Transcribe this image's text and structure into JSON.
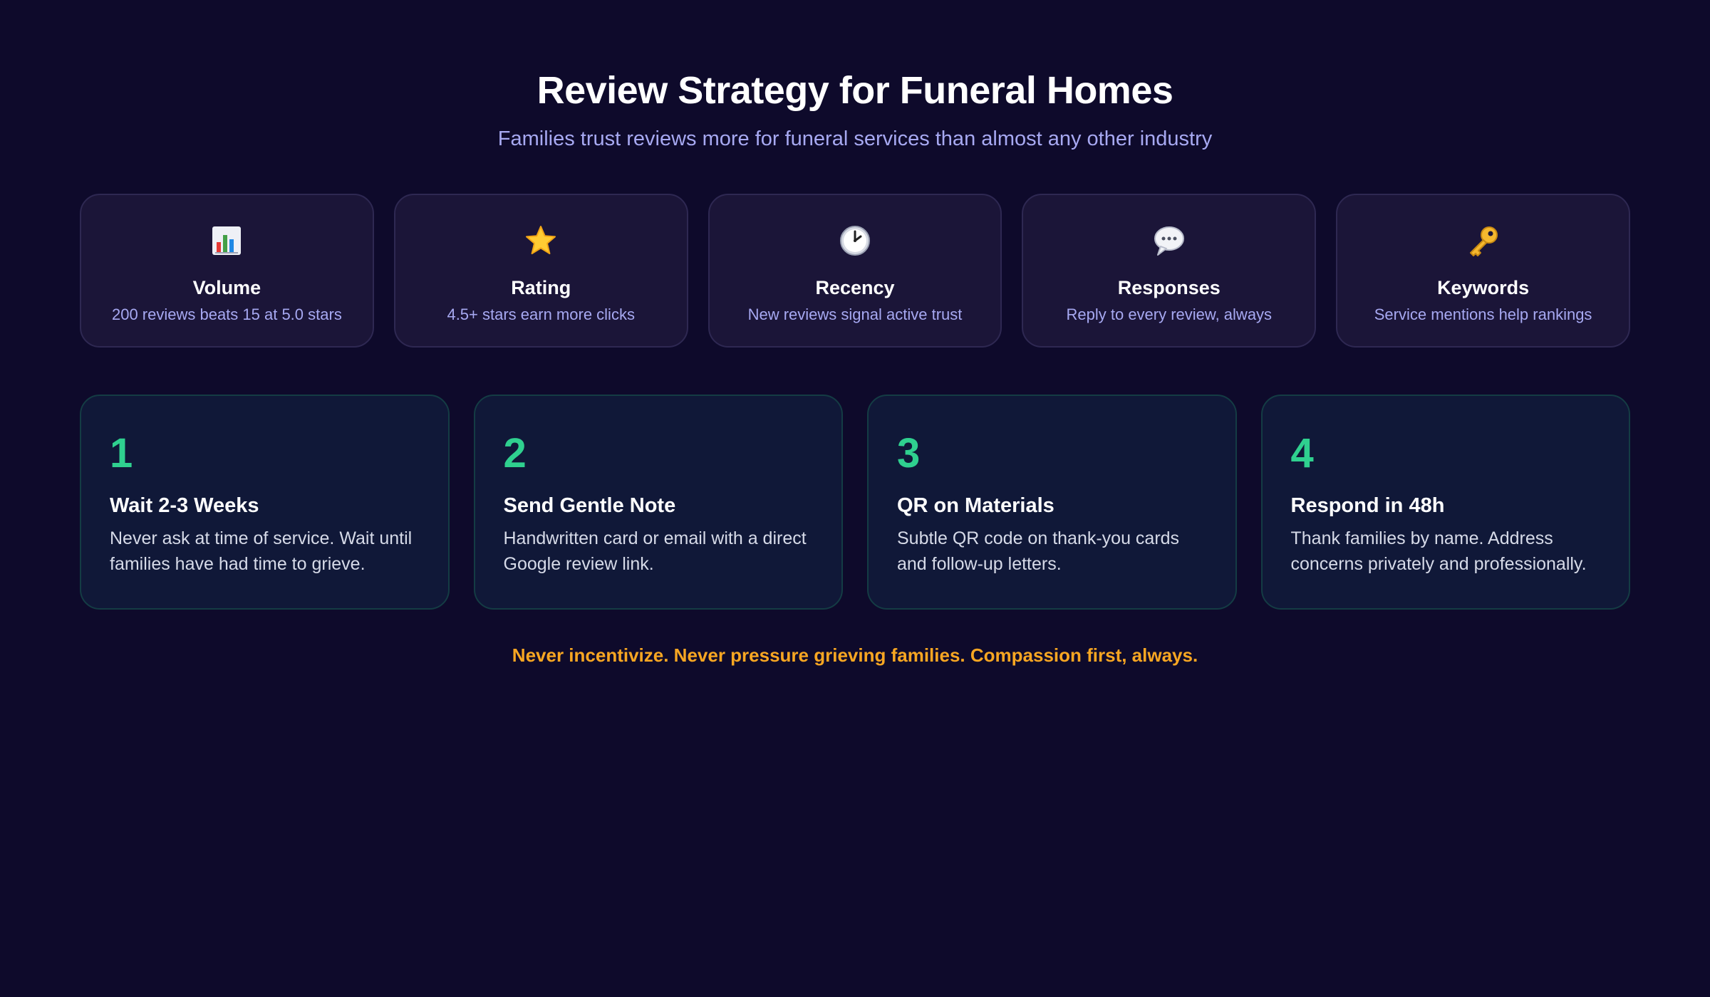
{
  "header": {
    "title": "Review Strategy for Funeral Homes",
    "subtitle": "Families trust reviews more for funeral services than almost any other industry"
  },
  "factors": [
    {
      "icon": "bar-chart-icon",
      "title": "Volume",
      "description": "200 reviews beats 15 at 5.0 stars"
    },
    {
      "icon": "star-icon",
      "title": "Rating",
      "description": "4.5+ stars earn more clicks"
    },
    {
      "icon": "clock-icon",
      "title": "Recency",
      "description": "New reviews signal active trust"
    },
    {
      "icon": "speech-bubble-icon",
      "title": "Responses",
      "description": "Reply to every review, always"
    },
    {
      "icon": "key-icon",
      "title": "Keywords",
      "description": "Service mentions help rankings"
    }
  ],
  "steps": [
    {
      "number": "1",
      "title": "Wait 2-3 Weeks",
      "description": "Never ask at time of service. Wait until families have had time to grieve."
    },
    {
      "number": "2",
      "title": "Send Gentle Note",
      "description": "Handwritten card or email with a direct Google review link."
    },
    {
      "number": "3",
      "title": "QR on Materials",
      "description": "Subtle QR code on thank-you cards and follow-up letters."
    },
    {
      "number": "4",
      "title": "Respond in 48h",
      "description": "Thank families by name. Address concerns privately and professionally."
    }
  ],
  "footer": {
    "note": "Never incentivize. Never pressure grieving families. Compassion first, always."
  },
  "colors": {
    "background": "#0e0a2b",
    "accent_green": "#2fd08f",
    "accent_orange": "#f7a622",
    "subtitle_lavender": "#a7a9f2"
  }
}
